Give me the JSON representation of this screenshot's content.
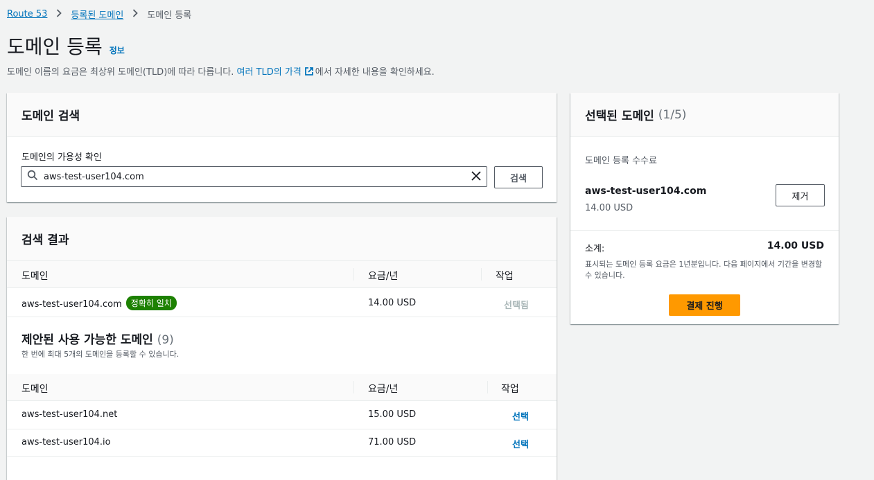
{
  "breadcrumb": {
    "items": [
      "Route 53",
      "등록된 도메인",
      "도메인 등록"
    ]
  },
  "header": {
    "title": "도메인 등록",
    "info": "정보",
    "desc_prefix": "도메인 이름의 요금은 최상위 도메인(TLD)에 따라 다릅니다. ",
    "desc_link": "여러 TLD의 가격",
    "desc_suffix": "에서 자세한 내용을 확인하세요."
  },
  "search": {
    "panel_title": "도메인 검색",
    "field_label": "도메인의 가용성 확인",
    "value": "aws-test-user104.com",
    "button": "검색"
  },
  "results": {
    "panel_title": "검색 결과",
    "columns": [
      "도메인",
      "요금/년",
      "작업"
    ],
    "exact": {
      "domain": "aws-test-user104.com",
      "badge": "정확히 일치",
      "price": "14.00 USD",
      "action": "선택됨"
    },
    "suggested_title": "제안된 사용 가능한 도메인",
    "suggested_count": "(9)",
    "suggested_sub": "한 번에 최대 5개의 도메인을 등록할 수 있습니다.",
    "suggested_columns": [
      "도메인",
      "요금/년",
      "작업"
    ],
    "suggested": [
      {
        "domain": "aws-test-user104.net",
        "price": "15.00 USD",
        "action": "선택"
      },
      {
        "domain": "aws-test-user104.io",
        "price": "71.00 USD",
        "action": "선택"
      }
    ]
  },
  "selected": {
    "panel_title": "선택된 도메인",
    "count": "(1/5)",
    "fee_label": "도메인 등록 수수료",
    "domain": "aws-test-user104.com",
    "price": "14.00 USD",
    "remove_button": "제거",
    "subtotal_label": "소계:",
    "subtotal_value": "14.00 USD",
    "note": "표시되는 도메인 등록 요금은 1년분입니다. 다음 페이지에서 기간을 변경할 수 있습니다.",
    "checkout_button": "결제 진행"
  },
  "colors": {
    "link": "#0073bb",
    "badge": "#1d8102",
    "primary_button": "#ff9900"
  }
}
